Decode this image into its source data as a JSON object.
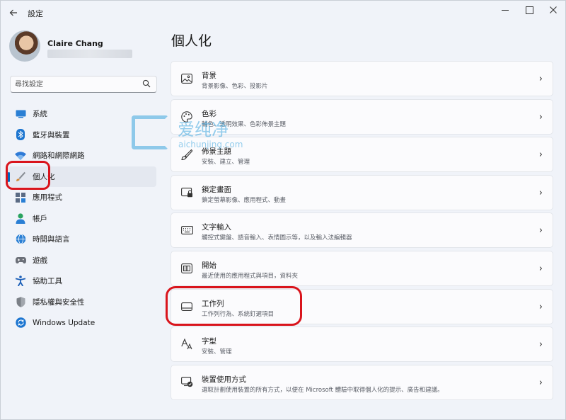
{
  "window": {
    "title": "設定",
    "back_icon": "arrow-left-icon",
    "controls": [
      "minimize",
      "maximize",
      "close"
    ]
  },
  "profile": {
    "name": "Claire Chang"
  },
  "search": {
    "placeholder": "尋找設定"
  },
  "sidebar": {
    "items": [
      {
        "label": "系統",
        "icon": "system-monitor-icon",
        "color": "#2a7fd4"
      },
      {
        "label": "藍牙與裝置",
        "icon": "bluetooth-icon",
        "color": "#1c75d0"
      },
      {
        "label": "網路和網際網路",
        "icon": "wifi-icon",
        "color": "#2f7ad6"
      },
      {
        "label": "個人化",
        "icon": "paintbrush-icon",
        "color": "#d08a3a",
        "active": true
      },
      {
        "label": "應用程式",
        "icon": "apps-icon",
        "color": "#5b6b84"
      },
      {
        "label": "帳戶",
        "icon": "person-icon",
        "color": "#2aa35f"
      },
      {
        "label": "時間與語言",
        "icon": "globe-clock-icon",
        "color": "#2a7fd4"
      },
      {
        "label": "遊戲",
        "icon": "gamepad-icon",
        "color": "#6b6f78"
      },
      {
        "label": "協助工具",
        "icon": "accessibility-icon",
        "color": "#1b5fb8"
      },
      {
        "label": "隱私權與安全性",
        "icon": "shield-icon",
        "color": "#7b8087"
      },
      {
        "label": "Windows Update",
        "icon": "windows-update-icon",
        "color": "#1c75d0"
      }
    ]
  },
  "main": {
    "title": "個人化",
    "cards": [
      {
        "title": "背景",
        "desc": "背景影像、色彩、投影片",
        "icon": "image-icon"
      },
      {
        "title": "色彩",
        "desc": "輔色、透明效果、色彩佈景主題",
        "icon": "palette-icon"
      },
      {
        "title": "佈景主題",
        "desc": "安裝、建立、管理",
        "icon": "brush-icon"
      },
      {
        "title": "鎖定畫面",
        "desc": "鎖定螢幕影像、應用程式、動畫",
        "icon": "lock-screen-icon"
      },
      {
        "title": "文字輸入",
        "desc": "觸控式鍵盤、語音輸入、表情圖示等，以及輸入法編輯器",
        "icon": "keyboard-icon"
      },
      {
        "title": "開始",
        "desc": "最近使用的應用程式與項目，資料夾",
        "icon": "start-menu-icon"
      },
      {
        "title": "工作列",
        "desc": "工作列行為、系統釘選項目",
        "icon": "taskbar-icon"
      },
      {
        "title": "字型",
        "desc": "安裝、管理",
        "icon": "font-icon"
      },
      {
        "title": "裝置使用方式",
        "desc": "選取計劃使用裝置的所有方式，以便在 Microsoft 體驗中取得個人化的提示、廣告和建議。",
        "icon": "device-usage-icon"
      }
    ]
  },
  "watermark": {
    "text": "爱纯净",
    "url": "aichunjing.com"
  },
  "colors": {
    "accent": "#0067c0",
    "highlight_ring": "#d9141c",
    "watermark": "#3fa7df"
  }
}
